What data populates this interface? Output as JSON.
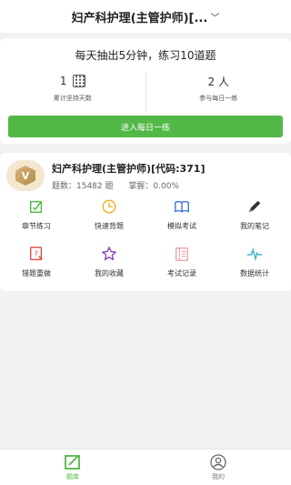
{
  "header": {
    "title": "妇产科护理(主管护师)[...",
    "chevron": "﹀"
  },
  "daily": {
    "motto": "每天抽出5分钟，练习10道题",
    "stats": [
      {
        "value": "1",
        "label": "累计坚持天数",
        "icon": "calendar-icon"
      },
      {
        "value": "2 人",
        "label": "参与每日一练"
      }
    ],
    "button_label": "进入每日一练"
  },
  "course": {
    "badge_letter": "V",
    "title": "妇产科护理(主管护师)[代码:371]",
    "count_text": "题数：15482 题",
    "mastery_text": "掌握：0.00%"
  },
  "features": [
    {
      "label": "章节练习",
      "icon": "chapter-practice-icon",
      "color": "#52b847"
    },
    {
      "label": "快速背题",
      "icon": "clock-icon",
      "color": "#f0b429"
    },
    {
      "label": "模拟考试",
      "icon": "book-icon",
      "color": "#3b6fd8"
    },
    {
      "label": "我的笔记",
      "icon": "pencil-icon",
      "color": "#333333"
    },
    {
      "label": "错题重做",
      "icon": "wrong-question-icon",
      "color": "#e04848"
    },
    {
      "label": "我的收藏",
      "icon": "star-icon",
      "color": "#8a3fb8"
    },
    {
      "label": "考试记录",
      "icon": "record-icon",
      "color": "#e8a0a0"
    },
    {
      "label": "数据统计",
      "icon": "pulse-icon",
      "color": "#3ab8c8"
    }
  ],
  "tabs": [
    {
      "label": "题库",
      "icon": "question-bank-icon",
      "active": true
    },
    {
      "label": "我的",
      "icon": "profile-icon",
      "active": false
    }
  ],
  "colors": {
    "accent": "#52b847",
    "background": "#f2f2f2"
  }
}
